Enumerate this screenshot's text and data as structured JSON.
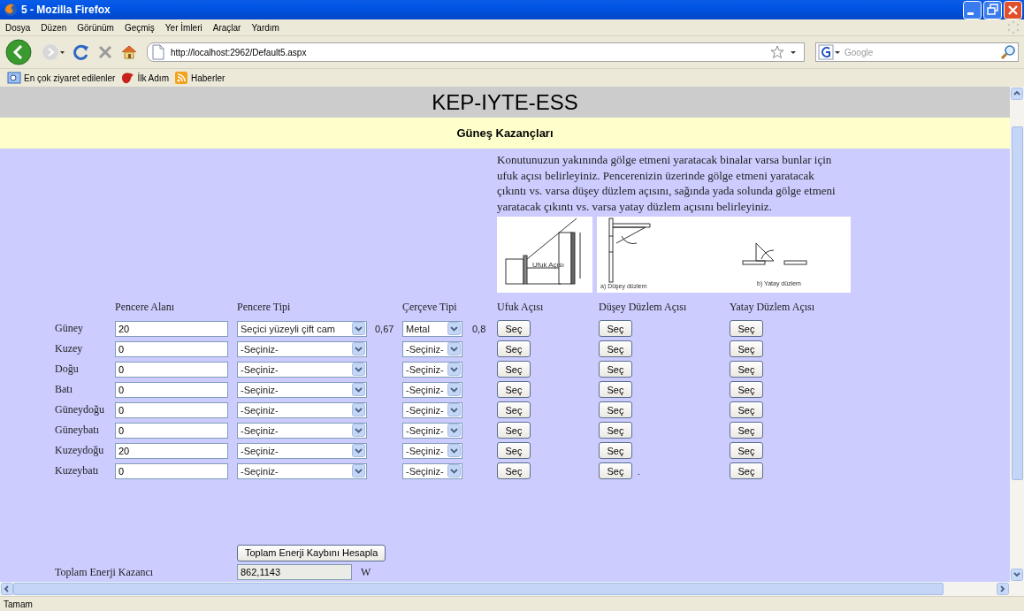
{
  "window": {
    "title": "5 - Mozilla Firefox"
  },
  "menu": [
    "Dosya",
    "Düzen",
    "Görünüm",
    "Geçmiş",
    "Yer İmleri",
    "Araçlar",
    "Yardım"
  ],
  "address": {
    "url": "http://localhost:2962/Default5.aspx"
  },
  "search": {
    "placeholder": "Google"
  },
  "bookmarks": [
    {
      "label": "En çok ziyaret edilenler",
      "kind": "search"
    },
    {
      "label": "İlk Adım",
      "kind": "start"
    },
    {
      "label": "Haberler",
      "kind": "feed"
    }
  ],
  "page": {
    "title": "KEP-IYTE-ESS",
    "subtitle": "Güneş Kazançları",
    "description": "Konutunuzun yakınında gölge etmeni yaratacak binalar varsa bunlar için ufuk açısı belirleyiniz. Pencerenizin üzerinde gölge etmeni yaratacak çıkıntı vs. varsa düşey düzlem açısını, sağında yada solunda gölge etmeni yaratacak çıkıntı vs. varsa yatay düzlem açısını belirleyiniz.",
    "figures": [
      {
        "kind": "horizon",
        "labels": [
          "Ufuk Açısı"
        ]
      },
      {
        "kind": "planes",
        "labels": [
          "a) Düşey düzlem",
          "b) Yatay düzlem"
        ]
      }
    ],
    "columns": [
      "Pencere Alanı",
      "Pencere Tipi",
      "Çerçeve Tipi",
      "Ufuk Açısı",
      "Düşey Düzlem Açısı",
      "Yatay Düzlem Açısı"
    ],
    "rows": [
      {
        "direction": "Güney",
        "area": "20",
        "window_type": "Seçici yüzeyli çift cam",
        "window_value": "0,67",
        "frame_type": "Metal",
        "frame_value": "0,8",
        "buttons": [
          "Seç",
          "Seç",
          "Seç"
        ]
      },
      {
        "direction": "Kuzey",
        "area": "0",
        "window_type": "-Seçiniz-",
        "frame_type": "-Seçiniz-",
        "buttons": [
          "Seç",
          "Seç",
          "Seç"
        ]
      },
      {
        "direction": "Doğu",
        "area": "0",
        "window_type": "-Seçiniz-",
        "frame_type": "-Seçiniz-",
        "buttons": [
          "Seç",
          "Seç",
          "Seç"
        ]
      },
      {
        "direction": "Batı",
        "area": "0",
        "window_type": "-Seçiniz-",
        "frame_type": "-Seçiniz-",
        "buttons": [
          "Seç",
          "Seç",
          "Seç"
        ]
      },
      {
        "direction": "Güneydoğu",
        "area": "0",
        "window_type": "-Seçiniz-",
        "frame_type": "-Seçiniz-",
        "buttons": [
          "Seç",
          "Seç",
          "Seç"
        ]
      },
      {
        "direction": "Güneybatı",
        "area": "0",
        "window_type": "-Seçiniz-",
        "frame_type": "-Seçiniz-",
        "buttons": [
          "Seç",
          "Seç",
          "Seç"
        ]
      },
      {
        "direction": "Kuzeydoğu",
        "area": "20",
        "window_type": "-Seçiniz-",
        "frame_type": "-Seçiniz-",
        "buttons": [
          "Seç",
          "Seç",
          "Seç"
        ]
      },
      {
        "direction": "Kuzeybatı",
        "area": "0",
        "window_type": "-Seçiniz-",
        "frame_type": "-Seçiniz-",
        "buttons": [
          "Seç",
          "Seç",
          "Seç"
        ],
        "note": "."
      }
    ],
    "calc_button": "Toplam Enerji Kaybını Hesapla",
    "total": {
      "label": "Toplam Enerji Kazancı",
      "value": "862,1143",
      "unit": "W"
    }
  },
  "status_bar": {
    "text": "Tamam"
  }
}
